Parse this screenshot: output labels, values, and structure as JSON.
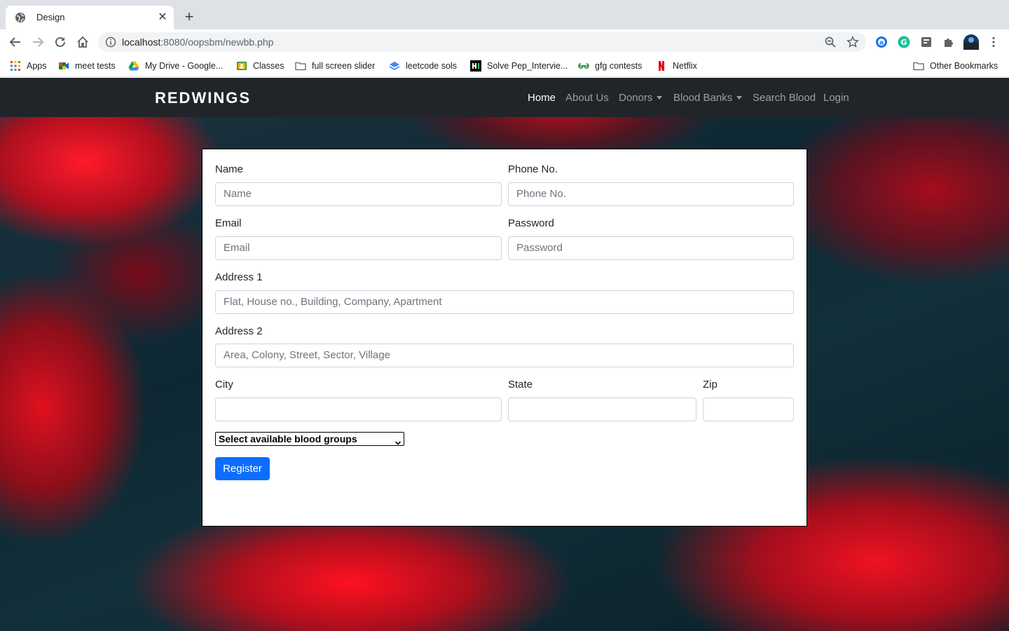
{
  "browser": {
    "tab_title": "Design",
    "url_host": "localhost",
    "url_rest": ":8080/oopsbm/newbb.php",
    "bookmarks": [
      {
        "label": "Apps",
        "icon": "apps-grid-icon"
      },
      {
        "label": "meet tests",
        "icon": "google-meet-icon"
      },
      {
        "label": "My Drive - Google...",
        "icon": "google-drive-icon"
      },
      {
        "label": "Classes",
        "icon": "google-classroom-icon"
      },
      {
        "label": "full screen slider",
        "icon": "folder-icon"
      },
      {
        "label": "leetcode sols",
        "icon": "stack-icon"
      },
      {
        "label": "Solve Pep_Intervie...",
        "icon": "hackerrank-icon"
      },
      {
        "label": "gfg contests",
        "icon": "gfg-icon"
      },
      {
        "label": "Netflix",
        "icon": "netflix-icon"
      }
    ],
    "other_bookmarks": "Other Bookmarks",
    "colors": {
      "tabstrip": "#dee1e6",
      "omnibox": "#f1f3f4"
    }
  },
  "navbar": {
    "brand": "REDWINGS",
    "links": [
      "Home",
      "About Us",
      "Donors",
      "Blood Banks",
      "Search Blood",
      "Login"
    ],
    "active": "Home"
  },
  "form": {
    "name": {
      "label": "Name",
      "placeholder": "Name"
    },
    "phone": {
      "label": "Phone No.",
      "placeholder": "Phone No."
    },
    "email": {
      "label": "Email",
      "placeholder": "Email"
    },
    "password": {
      "label": "Password",
      "placeholder": "Password"
    },
    "address1": {
      "label": "Address 1",
      "placeholder": "Flat, House no., Building, Company, Apartment"
    },
    "address2": {
      "label": "Address 2",
      "placeholder": "Area, Colony, Street, Sector, Village"
    },
    "city": {
      "label": "City",
      "value": ""
    },
    "state": {
      "label": "State",
      "value": ""
    },
    "zip": {
      "label": "Zip",
      "value": ""
    },
    "blood_group_select": "Select available blood groups",
    "submit": "Register",
    "colors": {
      "primary": "#0d6efd",
      "navbar": "#212529"
    }
  }
}
